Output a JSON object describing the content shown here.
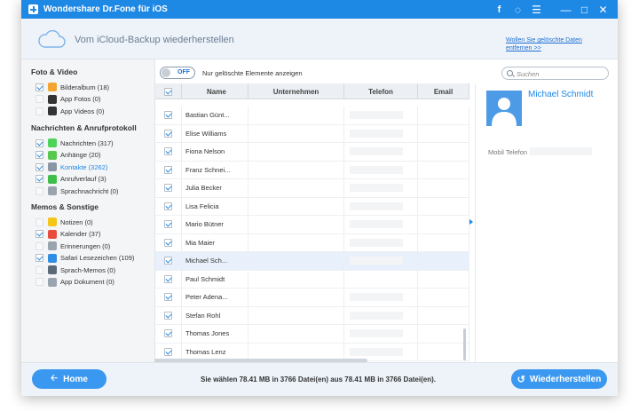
{
  "app": {
    "title": "Wondershare Dr.Fone für iOS",
    "controls": [
      "f",
      "◌",
      "☰",
      "—",
      "□",
      "✕"
    ]
  },
  "header": {
    "title": "Vom iCloud-Backup wiederherstellen",
    "link": "Wollen Sie gelöschte Daten entfernen >>"
  },
  "sidebar": {
    "sections": [
      {
        "title": "Foto & Video",
        "items": [
          {
            "label": "Bilderalbum (18)",
            "checked": true,
            "color": "#f3a531"
          },
          {
            "label": "App Fotos (0)",
            "checked": false,
            "color": "#333333"
          },
          {
            "label": "App Videos (0)",
            "checked": false,
            "color": "#333333"
          }
        ]
      },
      {
        "title": "Nachrichten & Anrufprotokoll",
        "items": [
          {
            "label": "Nachrichten (317)",
            "checked": true,
            "color": "#4cd35a"
          },
          {
            "label": "Anhänge (20)",
            "checked": true,
            "color": "#57c84d"
          },
          {
            "label": "Kontakte (3262)",
            "checked": true,
            "color": "#8a96a3",
            "active": true
          },
          {
            "label": "Anrufverlauf (3)",
            "checked": true,
            "color": "#3fbf4a"
          },
          {
            "label": "Sprachnachricht (0)",
            "checked": false,
            "color": "#9aa4ae"
          }
        ]
      },
      {
        "title": "Memos & Sonstige",
        "items": [
          {
            "label": "Notizen (0)",
            "checked": false,
            "color": "#f5c518"
          },
          {
            "label": "Kalender (37)",
            "checked": true,
            "color": "#e84c3d",
            "glyph": "10"
          },
          {
            "label": "Erinnerungen (0)",
            "checked": false,
            "color": "#9aa4ae"
          },
          {
            "label": "Safari Lesezeichen (109)",
            "checked": true,
            "color": "#2f8de4"
          },
          {
            "label": "Sprach-Memos (0)",
            "checked": false,
            "color": "#5b6a78"
          },
          {
            "label": "App Dokument (0)",
            "checked": false,
            "color": "#9aa4ae"
          }
        ]
      }
    ]
  },
  "toolbar": {
    "toggle_label": "OFF",
    "toggle_text": "Nur gelöschte Elemente anzeigen",
    "search_placeholder": "Suchen"
  },
  "table": {
    "columns": [
      "Name",
      "Unternehmen",
      "Telefon",
      "Email"
    ],
    "rows": [
      {
        "name": "Bastian Günt...",
        "phone_hidden": true
      },
      {
        "name": "Elise Williams",
        "phone_hidden": true
      },
      {
        "name": "Fiona Nelson",
        "phone_hidden": true
      },
      {
        "name": "Franz Schnei...",
        "phone_hidden": true
      },
      {
        "name": "Julia Becker",
        "phone_hidden": true
      },
      {
        "name": "Lisa Felicia",
        "phone_hidden": true
      },
      {
        "name": "Mario Bütner",
        "phone_hidden": true
      },
      {
        "name": "Mia Maier",
        "phone_hidden": true
      },
      {
        "name": "Michael Sch...",
        "phone_hidden": true,
        "selected": true
      },
      {
        "name": "Paul Schmidt",
        "phone_hidden": false
      },
      {
        "name": "Peter Adena...",
        "phone_hidden": true
      },
      {
        "name": "Stefan Rohl",
        "phone_hidden": true
      },
      {
        "name": "Thomas Jones",
        "phone_hidden": true
      },
      {
        "name": "Thomas Lenz",
        "phone_hidden": true
      }
    ]
  },
  "detail": {
    "name": "Michael  Schmidt",
    "label": "Mobil Telefon"
  },
  "footer": {
    "home": "Home",
    "status": "Sie wählen 78.41 MB in 3766 Datei(en) aus 78.41 MB in 3766 Datei(en).",
    "restore": "Wiederherstellen"
  },
  "colors": {
    "accent": "#1e88e5",
    "button": "#3b98f0"
  }
}
